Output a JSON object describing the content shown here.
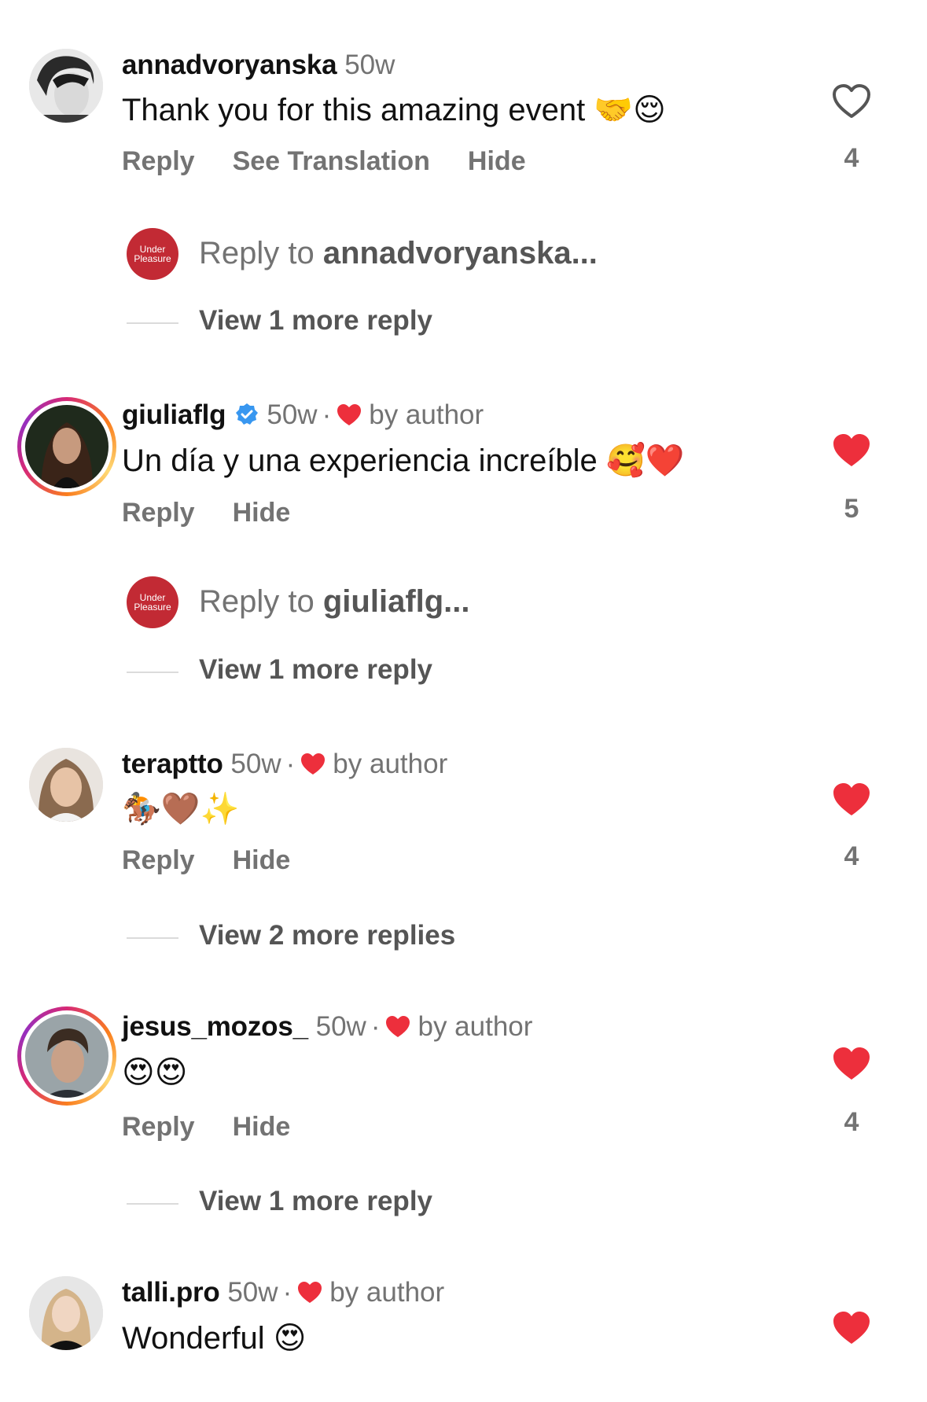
{
  "comments": [
    {
      "username": "annadvoryanska",
      "time": "50w",
      "text": "Thank you for this amazing event",
      "emojis": "🤝😌",
      "actions": [
        "Reply",
        "See Translation",
        "Hide"
      ],
      "liked": false,
      "likes": "4",
      "reply_to": {
        "prefix": "Reply to ",
        "name": "annadvoryanska..."
      },
      "view_more": "View 1 more reply"
    },
    {
      "username": "giuliaflg",
      "verified": true,
      "time": "50w",
      "dot": "·",
      "by_author": "by author",
      "text": "Un día y una experiencia increíble",
      "emojis": "🥰❤️",
      "actions": [
        "Reply",
        "Hide"
      ],
      "liked": true,
      "likes": "5",
      "reply_to": {
        "prefix": "Reply to ",
        "name": "giuliaflg..."
      },
      "view_more": "View 1 more reply"
    },
    {
      "username": "teraptto",
      "time": "50w",
      "dot": "·",
      "by_author": "by author",
      "emojis": "🏇🤎✨",
      "actions": [
        "Reply",
        "Hide"
      ],
      "liked": true,
      "likes": "4",
      "view_more": "View 2 more replies"
    },
    {
      "username": "jesus_mozos_",
      "time": "50w",
      "dot": "·",
      "by_author": "by author",
      "emojis": "😍😍",
      "actions": [
        "Reply",
        "Hide"
      ],
      "liked": true,
      "likes": "4",
      "view_more": "View 1 more reply"
    },
    {
      "username": "talli.pro",
      "time": "50w",
      "dot": "·",
      "by_author": "by author",
      "text": "Wonderful",
      "emojis": "😍",
      "liked": true
    }
  ],
  "brand_avatar": {
    "line1": "Under",
    "line2": "Pleasure",
    "color": "#c22a34"
  },
  "colors": {
    "like_red": "#ed2f3c",
    "muted": "#737373",
    "verified_blue": "#3897f0"
  }
}
